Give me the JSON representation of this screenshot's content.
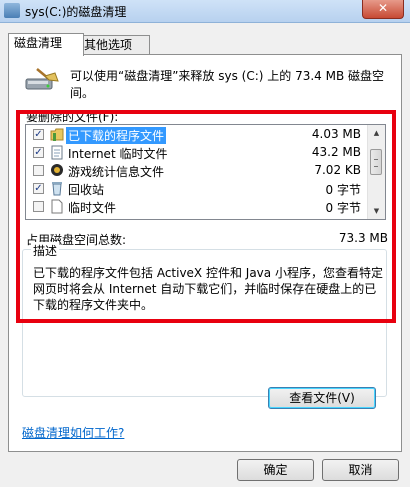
{
  "window": {
    "title": "sys(C:)的磁盘清理",
    "close_glyph": "✕"
  },
  "tabs": [
    {
      "label": "磁盘清理",
      "active": true
    },
    {
      "label": "其他选项",
      "active": false
    }
  ],
  "header": {
    "text": "可以使用“磁盘清理”来释放 sys (C:) 上的 73.4 MB 磁盘空间。"
  },
  "list": {
    "caption": "要删除的文件(F):",
    "items": [
      {
        "name": "已下载的程序文件",
        "size": "4.03 MB",
        "checked": true,
        "selected": true,
        "icon": "folder-icon"
      },
      {
        "name": "Internet 临时文件",
        "size": "43.2 MB",
        "checked": true,
        "selected": false,
        "icon": "page-icon"
      },
      {
        "name": "游戏统计信息文件",
        "size": "7.02 KB",
        "checked": false,
        "selected": false,
        "icon": "game-icon"
      },
      {
        "name": "回收站",
        "size": "0 字节",
        "checked": true,
        "selected": false,
        "icon": "recycle-bin-icon"
      },
      {
        "name": "临时文件",
        "size": "0 字节",
        "checked": false,
        "selected": false,
        "icon": "file-icon"
      }
    ]
  },
  "total": {
    "label": "占用磁盘空间总数:",
    "value": "73.3 MB"
  },
  "description": {
    "title": "描述",
    "text": "已下载的程序文件包括 ActiveX 控件和 Java 小程序，您查看特定网页时将会从 Internet 自动下载它们，并临时保存在硬盘上的已下载的程序文件夹中。"
  },
  "buttons": {
    "view_files": "查看文件(V)",
    "ok": "确定",
    "cancel": "取消"
  },
  "help_link": "磁盘清理如何工作?",
  "colors": {
    "highlight_border": "#e8000f",
    "selection": "#3399ff",
    "link": "#0066cc"
  }
}
